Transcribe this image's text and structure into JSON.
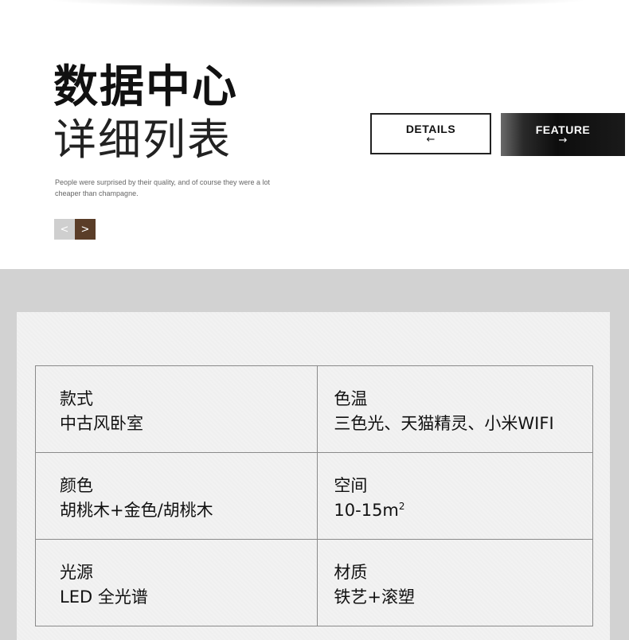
{
  "header": {
    "title": "数据中心",
    "subtitle": "详细列表",
    "description": "People were surprised by their quality, and of course they were a lot cheaper than champagne."
  },
  "pager": {
    "prev": "<",
    "next": ">"
  },
  "buttons": {
    "details": {
      "label": "DETAILS",
      "arrow": "←"
    },
    "feature": {
      "label": "FEATURE",
      "arrow": "→"
    }
  },
  "specs": [
    {
      "label": "款式",
      "value": "中古风卧室"
    },
    {
      "label": "色温",
      "value": "三色光、天猫精灵、小米WIFI"
    },
    {
      "label": "颜色",
      "value": "胡桃木+金色/胡桃木"
    },
    {
      "label": "空间",
      "value": "10-15m",
      "value_sup": "2"
    },
    {
      "label": "光源",
      "value": "LED 全光谱"
    },
    {
      "label": "材质",
      "value": "铁艺+滚塑"
    }
  ]
}
